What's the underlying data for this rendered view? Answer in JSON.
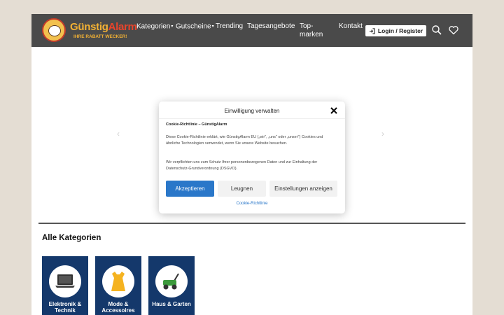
{
  "header": {
    "logo_name_1": "Günstig",
    "logo_name_2": "Alarm",
    "logo_tagline": "IHRE RABATT WECKER!",
    "nav": [
      {
        "label": "Kategorien",
        "caret": true
      },
      {
        "label": "Gutscheine",
        "caret": true
      },
      {
        "label": "Trending",
        "caret": false
      },
      {
        "label": "Tagesangebote",
        "caret": false
      },
      {
        "label": "Top-marken",
        "caret": false
      },
      {
        "label": "Kontakt",
        "caret": false
      }
    ],
    "login_label": "Login / Register",
    "icons": [
      "login-icon",
      "search-icon",
      "heart-icon"
    ]
  },
  "carousel": {
    "prev_arrow": "‹",
    "next_arrow": "›"
  },
  "consent": {
    "title": "Einwilligung verwalten",
    "policy_heading": "Cookie-Richtlinie – GünstigAlarm",
    "paragraph_1": "Diese Cookie-Richtlinie erklärt, wie GünstigAlarm EU („wir\", „uns\" oder „unser\") Cookies und ähnliche Technologien verwendet, wenn Sie unsere Website besuchen.",
    "paragraph_2": "Wir verpflichten uns zum Schutz Ihrer personenbezogenen Daten und zur Einhaltung der Datenschutz-Grundverordnung (DSGVO).",
    "accept_label": "Akzeptieren",
    "deny_label": "Leugnen",
    "settings_label": "Einstellungen anzeigen",
    "policy_link": "Cookie-Richtlinie"
  },
  "categories": {
    "title": "Alle Kategorien",
    "items": [
      {
        "label": "Elektronik & Technik",
        "icon": "laptop-icon"
      },
      {
        "label": "Mode & Accessoires",
        "icon": "dress-icon"
      },
      {
        "label": "Haus & Garten",
        "icon": "lawnmower-icon"
      }
    ]
  },
  "colors": {
    "header_bg": "#4a4a4a",
    "accent_blue": "#2a77c9",
    "category_bg": "#14386b",
    "logo_yellow": "#f2b134",
    "logo_red": "#e8442b"
  }
}
